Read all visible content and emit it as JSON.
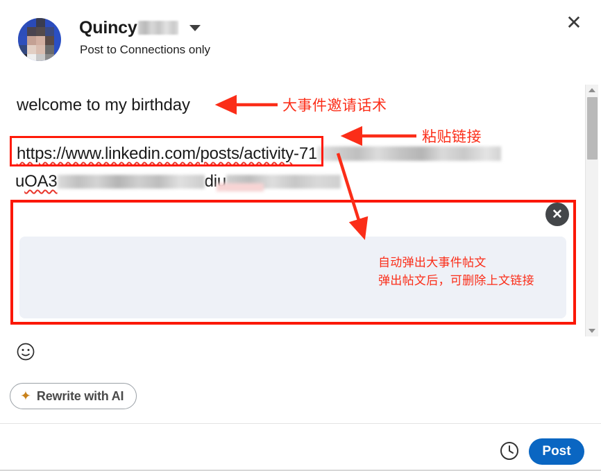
{
  "window": {
    "close_icon": "close-x"
  },
  "header": {
    "user_name": "Quincy",
    "name_redacted": true,
    "audience": "Post to Connections only",
    "dropdown_icon": "chevron-down-icon",
    "avatar_icon": "avatar"
  },
  "composer": {
    "post_text": "welcome to my birthday",
    "url_text": "https://www.linkedin.com/posts/activity",
    "url_suffix": "-71",
    "url_line2_prefix": "u",
    "url_line2_mid": "OA3",
    "url_line2_tail": "diu",
    "preview_close_icon": "close-circle-icon"
  },
  "tools": {
    "emoji_icon": "emoji-smiley-icon",
    "rewrite_label": "Rewrite with AI",
    "sparkle_icon": "sparkle-icon"
  },
  "footer": {
    "clock_icon": "clock-icon",
    "post_label": "Post"
  },
  "annotations": [
    {
      "id": "anno-1",
      "text": "大事件邀请话术"
    },
    {
      "id": "anno-2",
      "text": "粘贴链接"
    },
    {
      "id": "anno-3",
      "text": "自动弹出大事件帖文"
    },
    {
      "id": "anno-4",
      "text": "弹出帖文后，可删除上文链接"
    }
  ],
  "colors": {
    "annotation_red": "#fb2d18",
    "highlight_box_red": "#ff1a08",
    "post_button_blue": "#0a66c2",
    "sparkle_orange": "#c9821c",
    "preview_bg": "#eef1f7"
  }
}
